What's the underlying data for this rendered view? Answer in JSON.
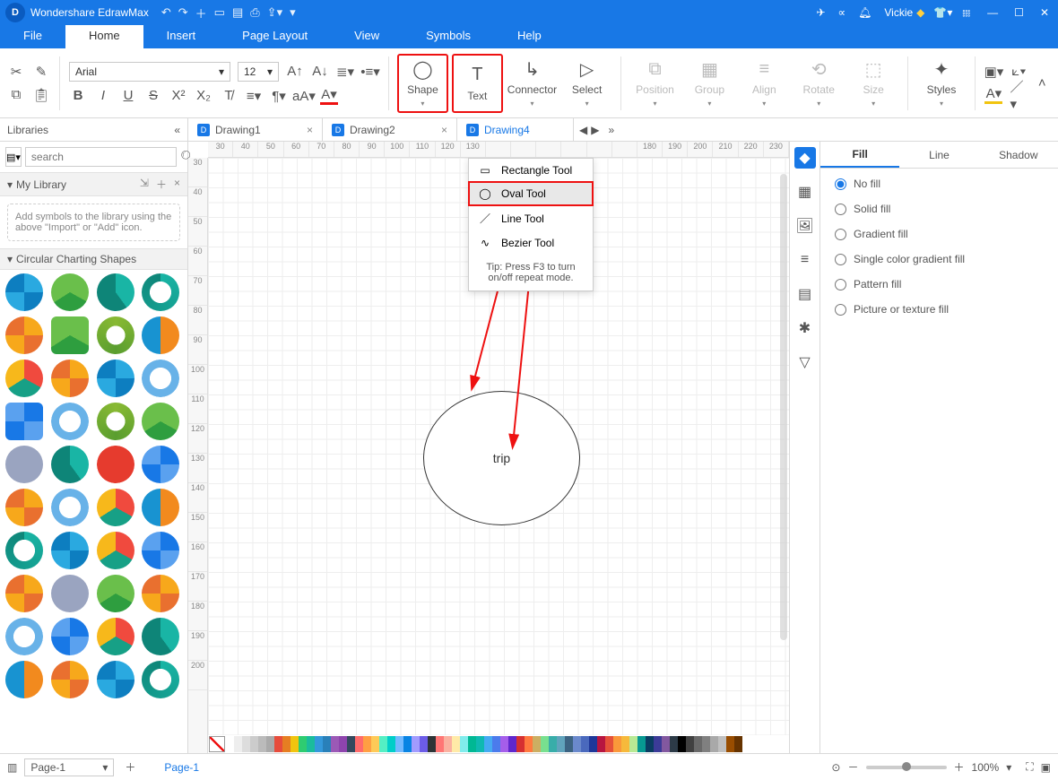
{
  "app": {
    "title": "Wondershare EdrawMax",
    "user": "Vickie"
  },
  "menu": {
    "items": [
      "File",
      "Home",
      "Insert",
      "Page Layout",
      "View",
      "Symbols",
      "Help"
    ],
    "active": 1
  },
  "ribbon": {
    "font": "Arial",
    "size": "12",
    "big": {
      "shape": "Shape",
      "text": "Text",
      "connector": "Connector",
      "select": "Select",
      "position": "Position",
      "group": "Group",
      "align": "Align",
      "rotate": "Rotate",
      "size": "Size",
      "styles": "Styles"
    }
  },
  "tabs": {
    "lib_label": "Libraries",
    "items": [
      {
        "name": "Drawing1",
        "active": false
      },
      {
        "name": "Drawing2",
        "active": false
      },
      {
        "name": "Drawing4",
        "active": true
      }
    ]
  },
  "left": {
    "search_placeholder": "search",
    "mylib": "My Library",
    "hint": "Add symbols to the library using the above \"Import\" or \"Add\" icon.",
    "circ": "Circular Charting Shapes"
  },
  "dropdown": {
    "rect": "Rectangle Tool",
    "oval": "Oval Tool",
    "line": "Line Tool",
    "bezier": "Bezier Tool",
    "tip": "Tip: Press F3 to turn on/off repeat mode."
  },
  "canvas": {
    "shape_text": "trip"
  },
  "rulerH": [
    "30",
    "40",
    "50",
    "60",
    "70",
    "80",
    "90",
    "100",
    "110",
    "120",
    "130",
    "",
    "",
    "",
    "",
    "",
    "",
    "180",
    "190",
    "200",
    "210",
    "220",
    "230"
  ],
  "rulerV": [
    "30",
    "40",
    "50",
    "60",
    "70",
    "80",
    "90",
    "100",
    "110",
    "120",
    "130",
    "140",
    "150",
    "160",
    "170",
    "180",
    "190",
    "200"
  ],
  "right": {
    "tabs": [
      "Fill",
      "Line",
      "Shadow"
    ],
    "opts": [
      "No fill",
      "Solid fill",
      "Gradient fill",
      "Single color gradient fill",
      "Pattern fill",
      "Picture or texture fill"
    ],
    "checked": 0
  },
  "status": {
    "page": "Page-1",
    "pagelabel": "Page-1",
    "zoom": "100%"
  },
  "colors": [
    "#ffffff",
    "#eeeeee",
    "#dddddd",
    "#cccccc",
    "#bbbbbb",
    "#aaaaaa",
    "#e74c3c",
    "#e67e22",
    "#f1c40f",
    "#2ecc71",
    "#1abc9c",
    "#3498db",
    "#2980b9",
    "#9b59b6",
    "#8e44ad",
    "#34495e",
    "#ff6b6b",
    "#ff9f43",
    "#feca57",
    "#55efc4",
    "#00cec9",
    "#74b9ff",
    "#0984e3",
    "#a29bfe",
    "#6c5ce7",
    "#2d3436",
    "#ff7675",
    "#fab1a0",
    "#ffeaa7",
    "#81ecec",
    "#00b894",
    "#0fb9b1",
    "#45aaf2",
    "#4b7bec",
    "#a55eea",
    "#5f27cd",
    "#d63031",
    "#ff793f",
    "#ccae62",
    "#78e08f",
    "#38ada9",
    "#60a3bc",
    "#3c6382",
    "#6a89cc",
    "#4a69bd",
    "#1e3799",
    "#b71540",
    "#e55039",
    "#fa983a",
    "#f6b93b",
    "#b8e994",
    "#079992",
    "#0a3d62",
    "#3B3B98",
    "#82589F",
    "#2C3A47",
    "#000000",
    "#404040",
    "#696969",
    "#808080",
    "#a9a9a9",
    "#c0c0c0",
    "#994d00",
    "#663300"
  ]
}
